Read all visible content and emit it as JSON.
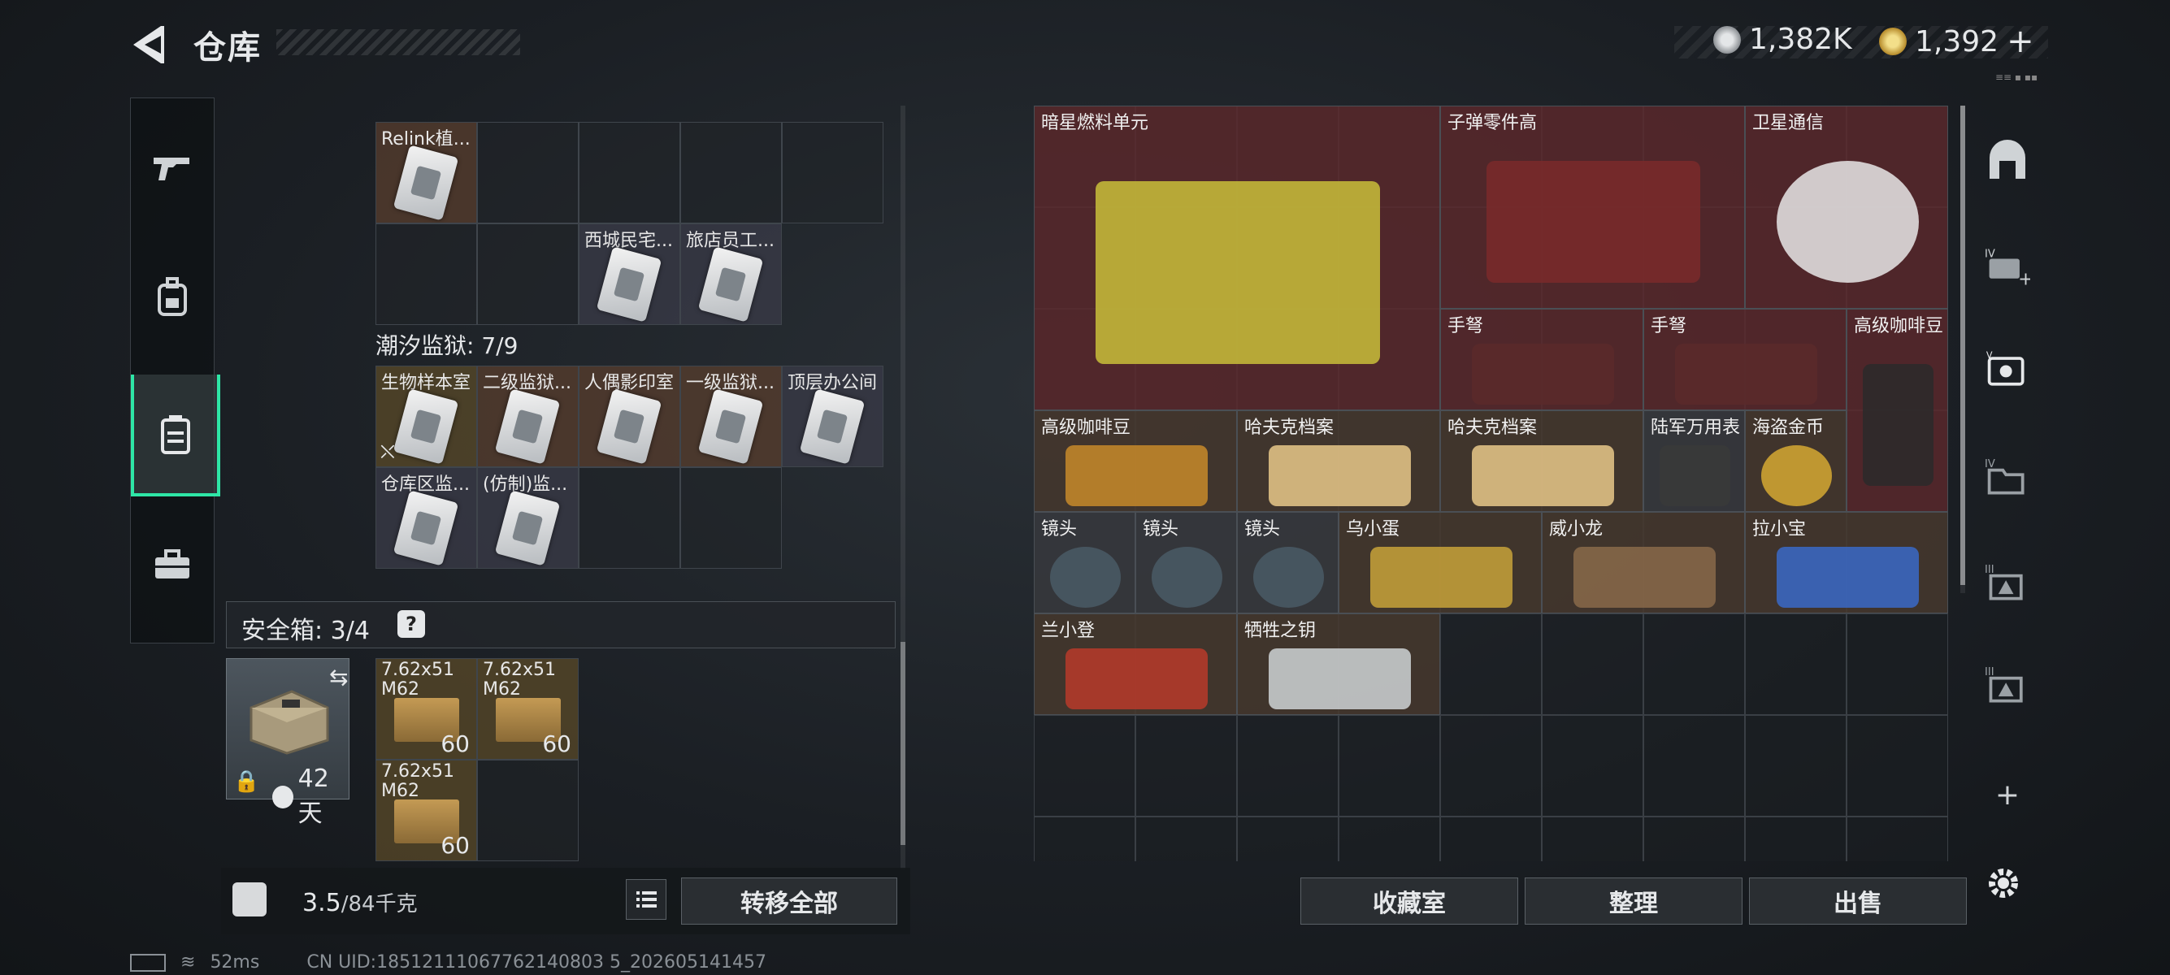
{
  "header": {
    "title": "仓库",
    "currency_a": "1,382K",
    "currency_b": "1,392",
    "currency_b_plus": "+"
  },
  "left_nav": {
    "items": [
      "weapon-icon",
      "backpack-icon",
      "stash-icon",
      "toolbox-icon"
    ],
    "active_index": 2
  },
  "left_stash": {
    "row1_items": [
      {
        "label": "Relink植...",
        "color": "warm"
      },
      {
        "label": "西城民宅...",
        "color": "blue"
      },
      {
        "label": "旅店员工...",
        "color": "blue"
      }
    ],
    "section_title": "潮汐监狱: 7/9",
    "section_items": [
      {
        "label": "生物样本室",
        "color": "gold"
      },
      {
        "label": "二级监狱...",
        "color": "warm"
      },
      {
        "label": "人偶影印室",
        "color": "warm"
      },
      {
        "label": "一级监狱...",
        "color": "warm"
      },
      {
        "label": "顶层办公间",
        "color": "blue"
      },
      {
        "label": "仓库区监...",
        "color": "blue"
      },
      {
        "label": "(仿制)监...",
        "color": "blue"
      }
    ],
    "safe_box_title": "安全箱: 3/4",
    "safe_box_help": "?",
    "safe_box_time": "42天",
    "ammo": [
      {
        "label": "7.62x51 M62",
        "count": "60"
      },
      {
        "label": "7.62x51 M62",
        "count": "60"
      },
      {
        "label": "7.62x51 M62",
        "count": "60"
      }
    ],
    "weight_current": "3.5",
    "weight_max": "/84千克",
    "transfer_all": "转移全部"
  },
  "right_stash": {
    "items": [
      {
        "label": "暗星燃料单元"
      },
      {
        "label": "子弹零件高"
      },
      {
        "label": "卫星通信"
      },
      {
        "label": "手弩"
      },
      {
        "label": "手弩"
      },
      {
        "label": "高级咖啡豆"
      },
      {
        "label": "高级咖啡豆"
      },
      {
        "label": "哈夫克档案"
      },
      {
        "label": "哈夫克档案"
      },
      {
        "label": "陆军万用表"
      },
      {
        "label": "海盗金币"
      },
      {
        "label": "镜头"
      },
      {
        "label": "镜头"
      },
      {
        "label": "镜头"
      },
      {
        "label": "乌小蛋"
      },
      {
        "label": "威小龙"
      },
      {
        "label": "拉小宝"
      },
      {
        "label": "兰小登"
      },
      {
        "label": "牺牲之钥"
      }
    ],
    "buttons": {
      "collection": "收藏室",
      "organize": "整理",
      "sell": "出售"
    }
  },
  "status_bar": {
    "ping": "52ms",
    "uid": "CN UID:18512111067762140803 5_202605141457"
  }
}
